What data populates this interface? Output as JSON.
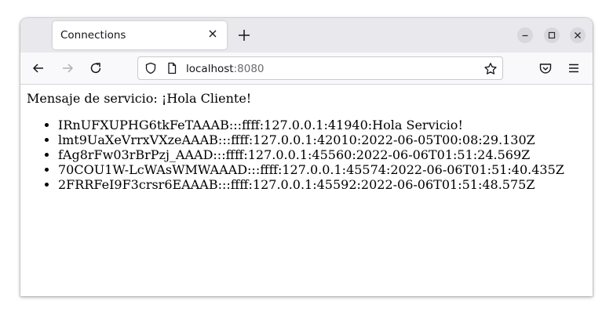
{
  "browser": {
    "tab_title": "Connections",
    "url_host": "localhost",
    "url_port": ":8080"
  },
  "page": {
    "service_message": "Mensaje de servicio: ¡Hola Cliente!",
    "connections": [
      "IRnUFXUPHG6tkFeTAAAB:::ffff:127.0.0.1:41940:Hola Servicio!",
      "lmt9UaXeVrrxVXzeAAAB:::ffff:127.0.0.1:42010:2022-06-05T00:08:29.130Z",
      "fAg8rFw03rBrPzj_AAAD:::ffff:127.0.0.1:45560:2022-06-06T01:51:24.569Z",
      "70COU1W-LcWAsWMWAAAD:::ffff:127.0.0.1:45574:2022-06-06T01:51:40.435Z",
      "2FRRFeI9F3crsr6EAAAB:::ffff:127.0.0.1:45592:2022-06-06T01:51:48.575Z"
    ]
  },
  "icons": {
    "tab_close": "close-icon",
    "new_tab": "plus-icon",
    "minimize": "minimize-icon",
    "maximize": "maximize-icon",
    "close_window": "close-icon",
    "back": "arrow-left-icon",
    "forward": "arrow-right-icon",
    "reload": "reload-icon",
    "tracking_protection": "shield-icon",
    "page_info": "page-icon",
    "bookmark": "star-icon",
    "pocket": "pocket-icon",
    "menu": "hamburger-icon"
  },
  "colors": {
    "tabbar_bg": "#e8e8ed",
    "navbar_bg": "#f9f9fb",
    "text": "#15141a",
    "port_text": "#6b6b70"
  }
}
